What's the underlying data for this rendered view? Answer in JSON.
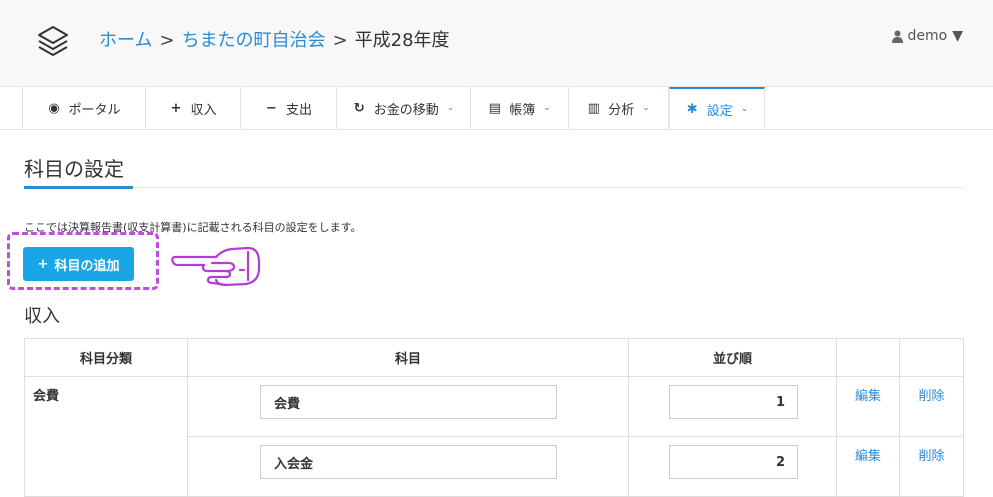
{
  "header": {
    "breadcrumb": [
      {
        "label": "ホーム",
        "link": true
      },
      {
        "label": "ちまたの町自治会",
        "link": true
      },
      {
        "label": "平成28年度",
        "link": false
      }
    ],
    "separator": ">",
    "user": {
      "name": "demo",
      "caret": "▼"
    }
  },
  "nav": {
    "items": [
      {
        "label": "ポータル",
        "icon": "dashboard-icon",
        "glyph": "◉"
      },
      {
        "label": "収入",
        "icon": "plus-icon",
        "glyph": "+"
      },
      {
        "label": "支出",
        "icon": "minus-icon",
        "glyph": "−"
      },
      {
        "label": "お金の移動",
        "icon": "refresh-icon",
        "glyph": "↻",
        "chevron": "⌄"
      },
      {
        "label": "帳簿",
        "icon": "document-icon",
        "glyph": "▤",
        "chevron": "⌄"
      },
      {
        "label": "分析",
        "icon": "bar-chart-icon",
        "glyph": "▥",
        "chevron": "⌄"
      },
      {
        "label": "設定",
        "icon": "gear-icon",
        "glyph": "✱",
        "chevron": "⌄",
        "active": true
      }
    ]
  },
  "main": {
    "title": "科目の設定",
    "description": "ここでは決算報告書(収支計算書)に記載される科目の設定をします。",
    "add_button": {
      "icon": "+",
      "label": "科目の追加"
    },
    "section_title": "収入",
    "table": {
      "headers": [
        "科目分類",
        "科目",
        "並び順",
        "",
        ""
      ],
      "category": "会費",
      "rows": [
        {
          "name": "会費",
          "order": "1",
          "edit": "編集",
          "delete": "削除"
        },
        {
          "name": "入会金",
          "order": "2",
          "edit": "編集",
          "delete": "削除"
        }
      ]
    }
  },
  "colors": {
    "accent": "#2b8bd4",
    "button": "#1aa6e6",
    "highlight": "#c04ce0"
  }
}
